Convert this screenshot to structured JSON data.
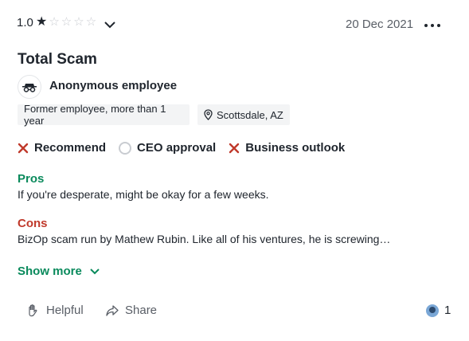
{
  "review": {
    "rating": "1.0",
    "rating_value": 1,
    "stars_total": 5,
    "date": "20 Dec 2021",
    "title": "Total Scam",
    "author": "Anonymous employee",
    "status": "Former employee, more than 1 year",
    "location": "Scottsdale, AZ",
    "opinions": {
      "recommend": "Recommend",
      "ceo": "CEO approval",
      "outlook": "Business outlook"
    },
    "pros_label": "Pros",
    "pros_text": "If you're desperate, might be okay for a few weeks.",
    "cons_label": "Cons",
    "cons_text": "BizOp scam run by Mathew Rubin. Like all of his ventures, he is screwing…",
    "show_more": "Show more",
    "helpful": "Helpful",
    "share": "Share",
    "helpful_count": "1"
  },
  "colors": {
    "pros": "#0a8a5c",
    "cons": "#c0392b",
    "negative_x": "#c0392b",
    "neutral": "#c9ccd1"
  },
  "icons": [
    "star-icon",
    "chevron-down-icon",
    "more-options-icon",
    "anonymous-user-icon",
    "location-pin-icon",
    "x-icon",
    "circle-icon",
    "helpful-hand-icon",
    "share-icon"
  ]
}
